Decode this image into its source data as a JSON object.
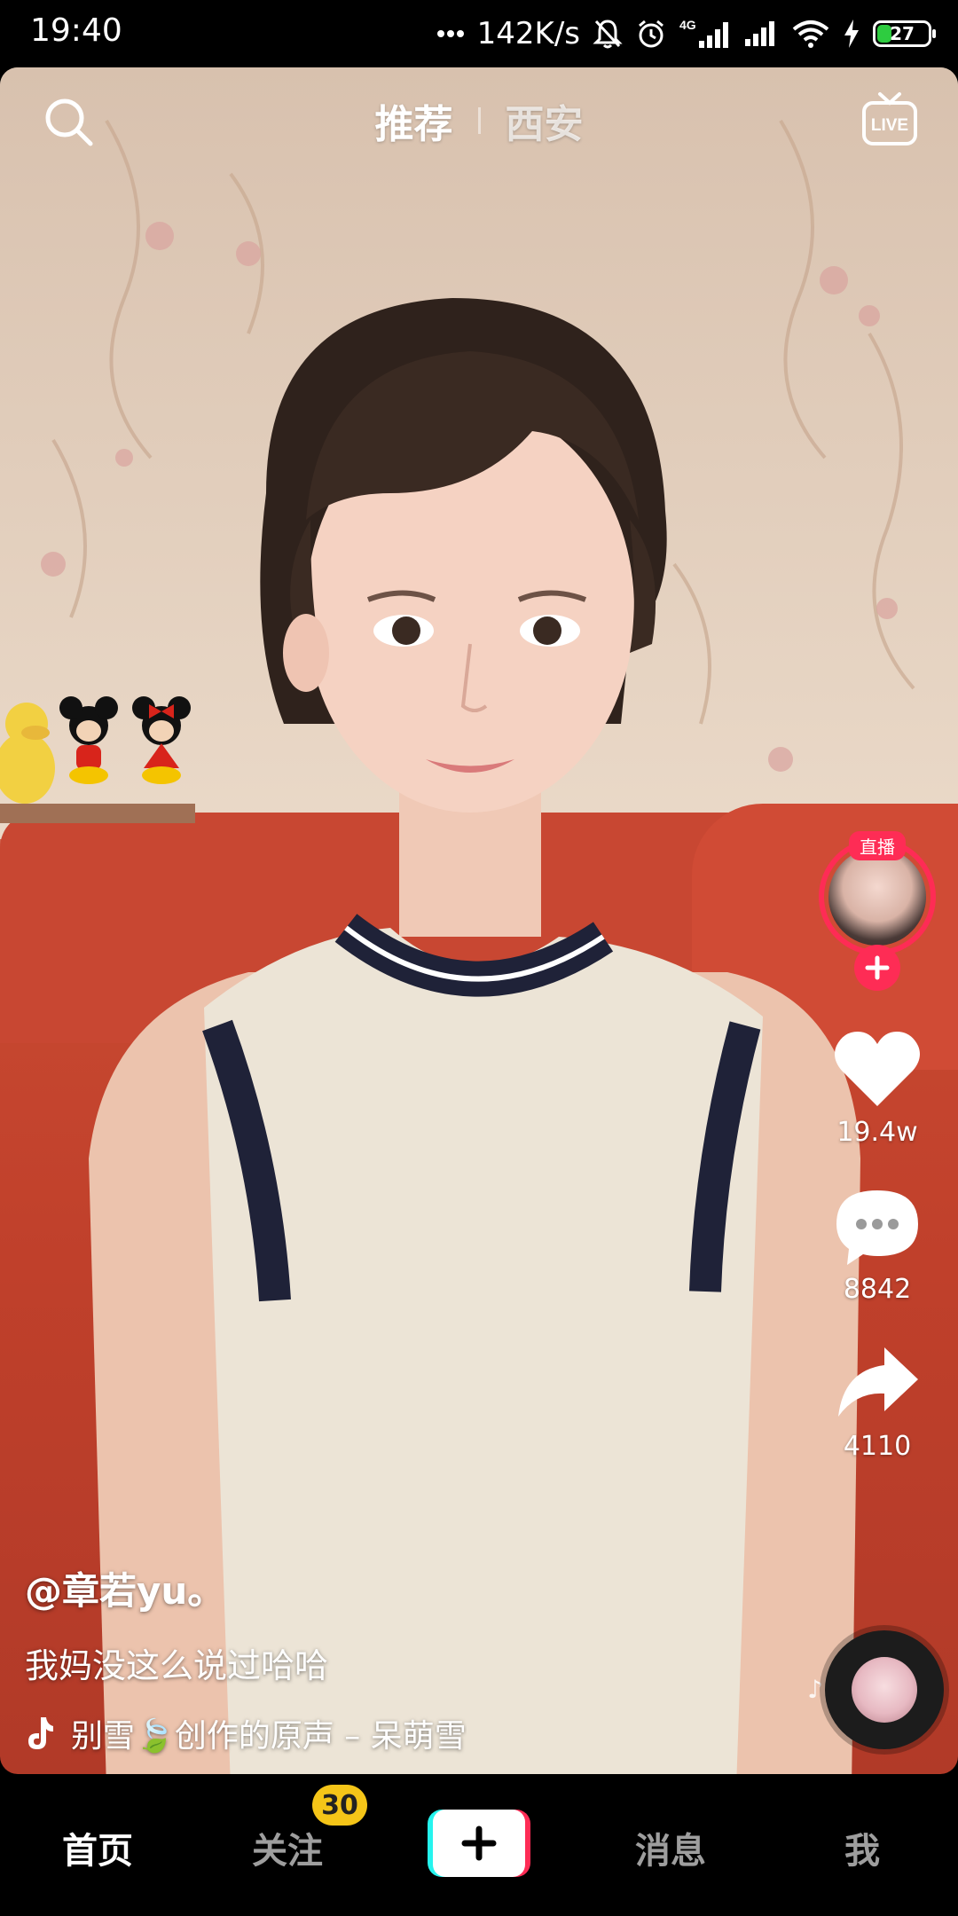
{
  "status_bar": {
    "time": "19:40",
    "net_speed": "142K/s",
    "network_type": "4G",
    "battery": "27",
    "battery_level": 0.27,
    "icons": [
      "more-dots-icon",
      "mute-bell-icon",
      "alarm-icon",
      "signal-4g-icon",
      "signal-icon",
      "wifi-icon",
      "charging-icon",
      "battery-icon"
    ]
  },
  "top_bar": {
    "search_icon": "search-icon",
    "tabs": [
      {
        "label": "推荐",
        "active": true
      },
      {
        "label": "西安",
        "active": false
      }
    ],
    "live_icon": "live-tv-icon",
    "live_icon_text": "LIVE"
  },
  "right_rail": {
    "avatar_live_tag": "直播",
    "follow_icon": "plus-icon",
    "like": {
      "icon": "heart-icon",
      "count": "19.4w"
    },
    "comment": {
      "icon": "comment-icon",
      "count": "8842"
    },
    "share": {
      "icon": "share-arrow-icon",
      "count": "4110"
    }
  },
  "caption": {
    "author": "@章若yu。",
    "description": "我妈没这么说过哈哈",
    "music_icon": "tiktok-note-icon",
    "music": "别雪🍃创作的原声 – 呆萌雪"
  },
  "bottom_nav": {
    "items": [
      {
        "label": "首页",
        "active": true
      },
      {
        "label": "关注",
        "active": false,
        "badge": "30"
      },
      {
        "label": "消息",
        "active": false
      },
      {
        "label": "我",
        "active": false
      }
    ],
    "create_icon": "plus-icon"
  },
  "colors": {
    "accent_red": "#fe2c55",
    "accent_cyan": "#25f4ee",
    "badge_yellow": "#f5c518"
  }
}
